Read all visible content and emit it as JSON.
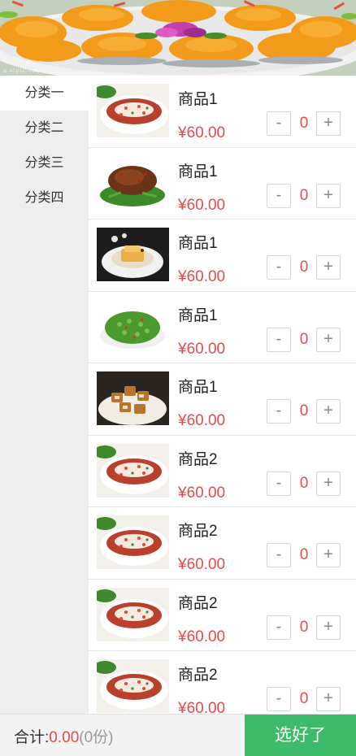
{
  "banner": {
    "watermark": "w.nipic.com/t"
  },
  "sidebar": {
    "items": [
      {
        "label": "分类一"
      },
      {
        "label": "分类二"
      },
      {
        "label": "分类三"
      },
      {
        "label": "分类四"
      }
    ]
  },
  "products": [
    {
      "name": "商品1",
      "price": "¥60.00",
      "qty": "0",
      "image": "noodle-soup-dish"
    },
    {
      "name": "商品1",
      "price": "¥60.00",
      "qty": "0",
      "image": "stir-fry-beef-dish"
    },
    {
      "name": "商品1",
      "price": "¥60.00",
      "qty": "0",
      "image": "tofu-dessert-dish"
    },
    {
      "name": "商品1",
      "price": "¥60.00",
      "qty": "0",
      "image": "green-peas-dish"
    },
    {
      "name": "商品1",
      "price": "¥60.00",
      "qty": "0",
      "image": "fried-tofu-dish"
    },
    {
      "name": "商品2",
      "price": "¥60.00",
      "qty": "0",
      "image": "noodle-soup-dish"
    },
    {
      "name": "商品2",
      "price": "¥60.00",
      "qty": "0",
      "image": "noodle-soup-dish"
    },
    {
      "name": "商品2",
      "price": "¥60.00",
      "qty": "0",
      "image": "noodle-soup-dish"
    },
    {
      "name": "商品2",
      "price": "¥60.00",
      "qty": "0",
      "image": "noodle-soup-dish"
    }
  ],
  "buttons": {
    "minus": "-",
    "plus": "+"
  },
  "footer": {
    "total_label": "合计:",
    "total_amount": "0.00",
    "total_count": "(0份)",
    "confirm_label": "选好了"
  },
  "colors": {
    "accent": "#3dbb6a",
    "price": "#e84b4b",
    "sidebar_bg": "#eeeeee"
  }
}
